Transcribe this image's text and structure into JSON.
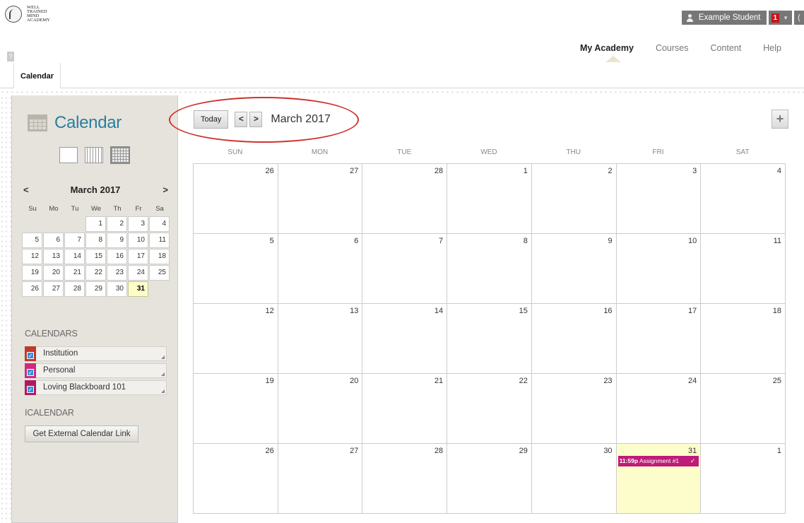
{
  "header": {
    "logo_text": "WELL TRAINED MIND ACADEMY",
    "user_name": "Example Student",
    "notification_count": "1",
    "nav": [
      "My Academy",
      "Courses",
      "Content",
      "Help"
    ]
  },
  "tabs": {
    "active": "Calendar"
  },
  "sidebar": {
    "title": "Calendar",
    "mini_calendar": {
      "title": "March 2017",
      "dow": [
        "Su",
        "Mo",
        "Tu",
        "We",
        "Th",
        "Fr",
        "Sa"
      ],
      "leading_blanks": 3,
      "days": [
        "1",
        "2",
        "3",
        "4",
        "5",
        "6",
        "7",
        "8",
        "9",
        "10",
        "11",
        "12",
        "13",
        "14",
        "15",
        "16",
        "17",
        "18",
        "19",
        "20",
        "21",
        "22",
        "23",
        "24",
        "25",
        "26",
        "27",
        "28",
        "29",
        "30",
        "31"
      ],
      "today": "31"
    },
    "calendars_label": "CALENDARS",
    "calendars": [
      {
        "name": "Institution",
        "color": "#c0392b"
      },
      {
        "name": "Personal",
        "color": "#cc2b7e"
      },
      {
        "name": "Loving Blackboard 101",
        "color": "#b3185e"
      }
    ],
    "ical_label": "ICALENDAR",
    "ext_link_label": "Get External Calendar Link"
  },
  "main": {
    "today_label": "Today",
    "prev_glyph": "<",
    "next_glyph": ">",
    "month_title": "March 2017",
    "add_glyph": "+",
    "dow": [
      "SUN",
      "MON",
      "TUE",
      "WED",
      "THU",
      "FRI",
      "SAT"
    ],
    "days": [
      "26",
      "27",
      "28",
      "1",
      "2",
      "3",
      "4",
      "5",
      "6",
      "7",
      "8",
      "9",
      "10",
      "11",
      "12",
      "13",
      "14",
      "15",
      "16",
      "17",
      "18",
      "19",
      "20",
      "21",
      "22",
      "23",
      "24",
      "25",
      "26",
      "27",
      "28",
      "29",
      "30",
      "31",
      "1"
    ],
    "today_index": 33,
    "event": {
      "time": "11:59p",
      "title": "Assignment #1",
      "color": "#bd1c78"
    }
  }
}
